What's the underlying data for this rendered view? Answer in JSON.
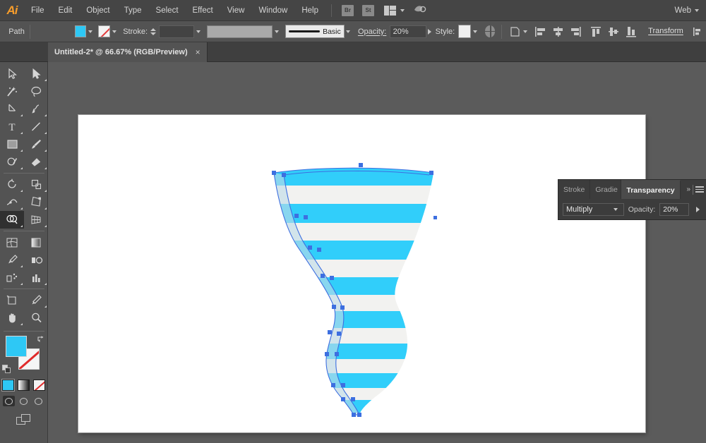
{
  "app": {
    "name": "Adobe Illustrator",
    "logo_text": "Ai"
  },
  "menubar": {
    "items": [
      "File",
      "Edit",
      "Object",
      "Type",
      "Select",
      "Effect",
      "View",
      "Window",
      "Help"
    ],
    "bridge_label": "Br",
    "stock_label": "St",
    "workspace_label": "Web"
  },
  "controlbar": {
    "object_type": "Path",
    "fill_color": "#2EC8F5",
    "stroke_color": "none",
    "stroke_label": "Stroke:",
    "stroke_weight": "",
    "stroke_profile": "",
    "brush_name": "Basic",
    "opacity_label": "Opacity:",
    "opacity_value": "20%",
    "style_label": "Style:",
    "transform_label": "Transform"
  },
  "tabs": {
    "documents": [
      {
        "title": "Untitled-2* @ 66.67% (RGB/Preview)",
        "close": "×",
        "active": true
      }
    ]
  },
  "toolbar": {
    "tools": [
      {
        "name": "selection-tool",
        "active": false
      },
      {
        "name": "direct-selection-tool",
        "active": false
      },
      {
        "name": "magic-wand-tool",
        "active": false
      },
      {
        "name": "lasso-tool",
        "active": false
      },
      {
        "name": "pen-tool",
        "active": false
      },
      {
        "name": "curvature-tool",
        "active": false
      },
      {
        "name": "type-tool",
        "active": false
      },
      {
        "name": "line-segment-tool",
        "active": false
      },
      {
        "name": "rectangle-tool",
        "active": false
      },
      {
        "name": "paintbrush-tool",
        "active": false
      },
      {
        "name": "shaper-tool",
        "active": false
      },
      {
        "name": "eraser-tool",
        "active": false
      },
      {
        "name": "rotate-tool",
        "active": false
      },
      {
        "name": "scale-tool",
        "active": false
      },
      {
        "name": "width-tool",
        "active": false
      },
      {
        "name": "free-transform-tool",
        "active": false
      },
      {
        "name": "shape-builder-tool",
        "active": true
      },
      {
        "name": "perspective-grid-tool",
        "active": false
      },
      {
        "name": "mesh-tool",
        "active": false
      },
      {
        "name": "gradient-tool",
        "active": false
      },
      {
        "name": "eyedropper-tool",
        "active": false
      },
      {
        "name": "blend-tool",
        "active": false
      },
      {
        "name": "symbol-sprayer-tool",
        "active": false
      },
      {
        "name": "column-graph-tool",
        "active": false
      },
      {
        "name": "artboard-tool",
        "active": false
      },
      {
        "name": "slice-tool",
        "active": false
      },
      {
        "name": "hand-tool",
        "active": false
      },
      {
        "name": "zoom-tool",
        "active": false
      }
    ],
    "fill_swatch_color": "#2EC8F5",
    "stroke_swatch_color": "none",
    "fillrow": [
      {
        "name": "color-button",
        "selected": true
      },
      {
        "name": "gradient-button",
        "selected": false
      },
      {
        "name": "none-button",
        "selected": false
      }
    ],
    "drawmodes": [
      {
        "name": "draw-normal",
        "active": true
      },
      {
        "name": "draw-behind",
        "active": false
      },
      {
        "name": "draw-inside",
        "active": false
      }
    ],
    "screen_mode": "change-screen-mode"
  },
  "panel": {
    "tabs": [
      {
        "label": "Stroke",
        "active": false
      },
      {
        "label": "Gradie",
        "active": false
      },
      {
        "label": "Transparency",
        "active": true
      }
    ],
    "expand_icon": "»",
    "blend_mode": "Multiply",
    "opacity_label": "Opacity:",
    "opacity_value": "20%"
  },
  "canvas": {
    "document_background": "#FFFFFF",
    "workspace_background": "#5B5B5B",
    "artwork_name": "striped-funnel-path",
    "stripe_color_cyan": "#31CEFA",
    "stripe_color_white": "#F2F2F0",
    "selection_color": "#3D6FE0",
    "zoom_level": "66.67%"
  }
}
